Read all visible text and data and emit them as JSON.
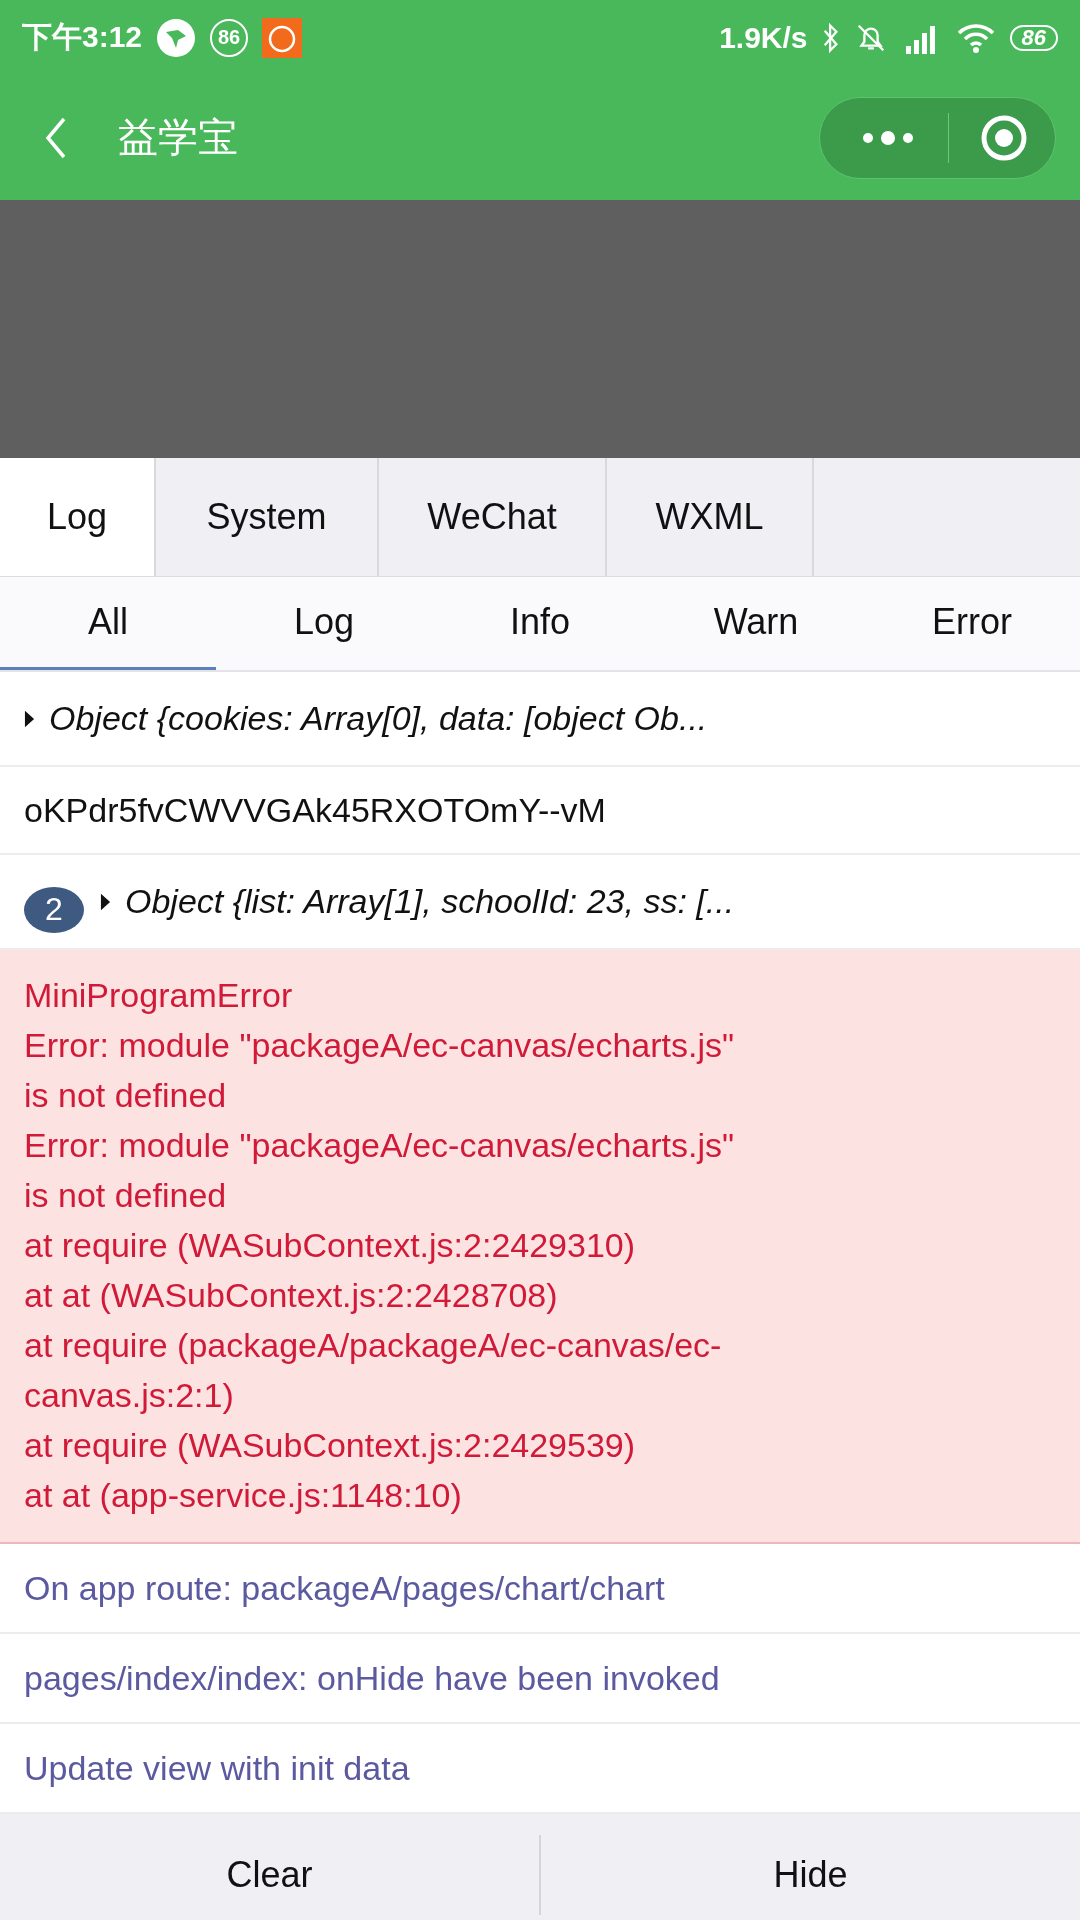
{
  "status_bar": {
    "time": "下午3:12",
    "notification_badge": "86",
    "network_speed": "1.9K/s",
    "battery": "86"
  },
  "nav_bar": {
    "title": "益学宝"
  },
  "tabs": [
    {
      "label": "Log",
      "selected": true
    },
    {
      "label": "System",
      "selected": false
    },
    {
      "label": "WeChat",
      "selected": false
    },
    {
      "label": "WXML",
      "selected": false
    }
  ],
  "filters": [
    {
      "label": "All",
      "selected": true
    },
    {
      "label": "Log",
      "selected": false
    },
    {
      "label": "Info",
      "selected": false
    },
    {
      "label": "Warn",
      "selected": false
    },
    {
      "label": "Error",
      "selected": false
    }
  ],
  "log_entries": [
    {
      "kind": "object",
      "text": "Object {cookies: Array[0], data: [object Ob..."
    },
    {
      "kind": "log",
      "text": "oKPdr5fvCWVVGAk45RXOTOmY--vM"
    },
    {
      "kind": "object",
      "count": "2",
      "text": "Object {list: Array[1], schoolId: 23, ss: [..."
    },
    {
      "kind": "error",
      "lines": [
        "MiniProgramError",
        "Error: module \"packageA/ec-canvas/echarts.js\"",
        "is not defined",
        "Error: module \"packageA/ec-canvas/echarts.js\"",
        "is not defined",
        "at require (WASubContext.js:2:2429310)",
        "at at (WASubContext.js:2:2428708)",
        "at require (packageA/packageA/ec-canvas/ec-",
        "canvas.js:2:1)",
        "at require (WASubContext.js:2:2429539)",
        "at at (app-service.js:1148:10)"
      ]
    },
    {
      "kind": "info",
      "text": "On app route: packageA/pages/chart/chart"
    },
    {
      "kind": "info",
      "text": "pages/index/index: onHide have been invoked"
    },
    {
      "kind": "info",
      "text": "Update view with init data"
    }
  ],
  "buttons": [
    "Clear",
    "Hide"
  ]
}
